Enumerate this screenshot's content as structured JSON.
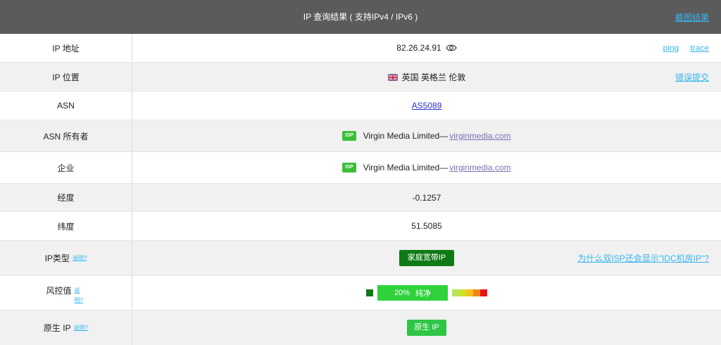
{
  "header": {
    "title": "IP 查询结果 ( 支持IPv4 / IPv6 )",
    "screenshot_link": "截图结果"
  },
  "rows": {
    "ip": {
      "label": "IP 地址",
      "value": "82.26.24.91",
      "links": [
        "ping",
        "trace"
      ]
    },
    "location": {
      "label": "IP 位置",
      "value": "英国 英格兰 伦敦",
      "flag": "uk-flag-icon",
      "link": "错误提交"
    },
    "asn": {
      "label": "ASN",
      "value": "AS5089"
    },
    "asn_owner": {
      "label": "ASN 所有者",
      "badge": "ISP",
      "name": "Virgin Media Limited—",
      "domain": "virginmedia.com"
    },
    "company": {
      "label": "企业",
      "badge": "ISP",
      "name": "Virgin Media Limited—",
      "domain": "virginmedia.com"
    },
    "longitude": {
      "label": "经度",
      "value": "-0.1257"
    },
    "latitude": {
      "label": "纬度",
      "value": "51.5085"
    },
    "ip_type": {
      "label": "IP类型",
      "help": "说明?",
      "value": "家庭宽带IP",
      "link": "为什么双ISP还会显示\"IDC机房IP\"?"
    },
    "risk": {
      "label": "风控值",
      "help_1": "说",
      "help_2": "明?",
      "percent": "20%",
      "text": "纯净",
      "percent_value": 20
    },
    "native_ip": {
      "label": "原生 IP",
      "help": "说明?",
      "value": "原生 IP"
    }
  },
  "colors": {
    "header_bg": "#5b5b5b",
    "link": "#36b6f0",
    "dark_green": "#0f7a15",
    "bright_green": "#2fd23b",
    "isp_green": "#3bbf3b"
  }
}
